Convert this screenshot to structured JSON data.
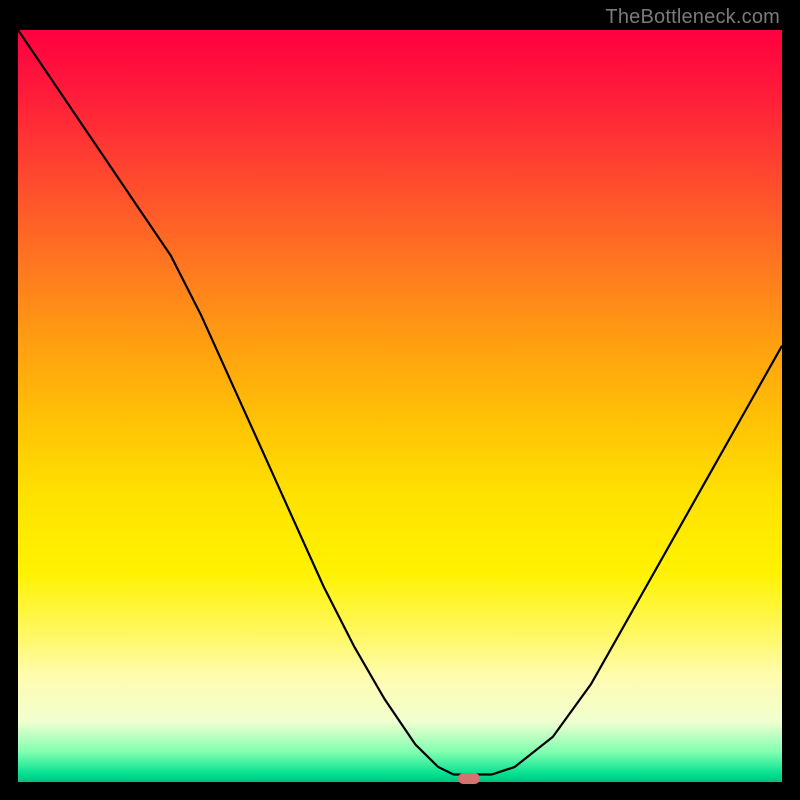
{
  "watermark": "TheBottleneck.com",
  "chart_data": {
    "type": "line",
    "title": "",
    "xlabel": "",
    "ylabel": "",
    "xlim": [
      0,
      100
    ],
    "ylim": [
      0,
      100
    ],
    "x": [
      0,
      4,
      8,
      12,
      16,
      20,
      24,
      28,
      32,
      36,
      40,
      44,
      48,
      52,
      55,
      57,
      59,
      62,
      65,
      70,
      75,
      80,
      85,
      90,
      95,
      100
    ],
    "values": [
      100,
      94,
      88,
      82,
      76,
      70,
      62,
      53,
      44,
      35,
      26,
      18,
      11,
      5,
      2,
      1,
      1,
      1,
      2,
      6,
      13,
      22,
      31,
      40,
      49,
      58
    ],
    "marker": {
      "x": 59,
      "y": 0
    },
    "colors": {
      "gradient_top": "#ff0040",
      "gradient_mid": "#ffe200",
      "gradient_bottom": "#00c080",
      "curve": "#000000",
      "marker": "#d1736f",
      "border": "#000000"
    }
  }
}
